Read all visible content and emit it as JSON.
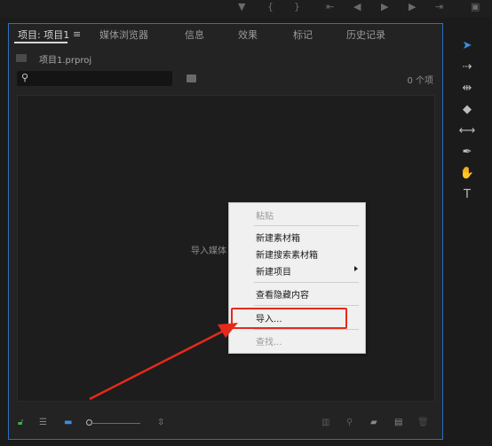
{
  "tabs": [
    {
      "label": "项目: 项目1"
    },
    {
      "label": "媒体浏览器"
    },
    {
      "label": "信息"
    },
    {
      "label": "效果"
    },
    {
      "label": "标记"
    },
    {
      "label": "历史记录"
    }
  ],
  "project": {
    "name": "项目1.prproj",
    "item_count": "0 个项"
  },
  "content": {
    "hint": "导入媒体"
  },
  "context_menu": {
    "items": [
      {
        "label": "粘贴",
        "enabled": false
      },
      {
        "label": "新建素材箱",
        "enabled": true
      },
      {
        "label": "新建搜索素材箱",
        "enabled": true
      },
      {
        "label": "新建项目",
        "enabled": true,
        "submenu": true
      },
      {
        "label": "查看隐藏内容",
        "enabled": true
      },
      {
        "label": "导入...",
        "enabled": true,
        "highlighted": true
      },
      {
        "label": "查找...",
        "enabled": false
      }
    ]
  },
  "colors": {
    "accent": "#2d6fbf",
    "selection_tool": "#3a8ee6",
    "annotation": "#e52a1c"
  }
}
